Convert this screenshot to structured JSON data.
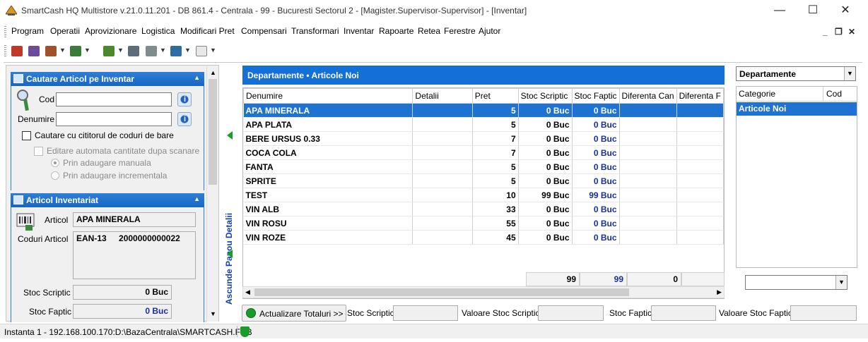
{
  "window": {
    "title": "SmartCash HQ Multistore v.21.0.11.201 - DB 861.4 - Centrala - 99 - Bucuresti Sectorul 2 - [Magister.Supervisor-Supervisor] - [Inventar]",
    "minimize": "—",
    "maximize": "☐",
    "close": "✕"
  },
  "menu": [
    "Program",
    "Operatii",
    "Aprovizionare",
    "Logistica",
    "Modificari Pret",
    "Compensari",
    "Transformari",
    "Inventar",
    "Rapoarte",
    "Retea",
    "Ferestre",
    "Ajutor"
  ],
  "mdi": {
    "minimize": "_",
    "restore": "❐",
    "close": "✕"
  },
  "search_group": {
    "title": "Cautare Articol pe Inventar",
    "cod_label": "Cod",
    "cod_value": "",
    "denumire_label": "Denumire",
    "denumire_value": "",
    "barcode_reader_label": "Cautare cu cititorul de coduri de bare",
    "auto_edit_label": "Editare automata cantitate dupa scanare",
    "manual_add_label": "Prin adaugare manuala",
    "incremental_add_label": "Prin adaugare incrementala"
  },
  "article_group": {
    "title": "Articol Inventariat",
    "articol_label": "Articol",
    "articol_value": "APA MINERALA",
    "coduri_label": "Coduri Articol",
    "code_type": "EAN-13",
    "code_value": "2000000000022",
    "stoc_scriptic_label": "Stoc Scriptic",
    "stoc_scriptic_value": "0 Buc",
    "stoc_faptic_label": "Stoc Faptic",
    "stoc_faptic_value": "0 Buc"
  },
  "splitter_label": "Ascunde Panou Detalii",
  "grid": {
    "title": "Departamente • Articole Noi",
    "columns": [
      "Denumire",
      "Detalii",
      "Pret",
      "Stoc Scriptic",
      "Stoc Faptic",
      "Diferenta Can",
      "Diferenta F"
    ],
    "rows": [
      {
        "denumire": "APA MINERALA",
        "detalii": "",
        "pret": "5",
        "scriptic": "0 Buc",
        "faptic": "0 Buc"
      },
      {
        "denumire": "APA PLATA",
        "detalii": "",
        "pret": "5",
        "scriptic": "0 Buc",
        "faptic": "0 Buc"
      },
      {
        "denumire": "BERE URSUS 0.33",
        "detalii": "",
        "pret": "7",
        "scriptic": "0 Buc",
        "faptic": "0 Buc"
      },
      {
        "denumire": "COCA COLA",
        "detalii": "",
        "pret": "7",
        "scriptic": "0 Buc",
        "faptic": "0 Buc"
      },
      {
        "denumire": "FANTA",
        "detalii": "",
        "pret": "5",
        "scriptic": "0 Buc",
        "faptic": "0 Buc"
      },
      {
        "denumire": "SPRITE",
        "detalii": "",
        "pret": "5",
        "scriptic": "0 Buc",
        "faptic": "0 Buc"
      },
      {
        "denumire": "TEST",
        "detalii": "",
        "pret": "10",
        "scriptic": "99 Buc",
        "faptic": "99 Buc"
      },
      {
        "denumire": "VIN ALB",
        "detalii": "",
        "pret": "33",
        "scriptic": "0 Buc",
        "faptic": "0 Buc"
      },
      {
        "denumire": "VIN ROSU",
        "detalii": "",
        "pret": "55",
        "scriptic": "0 Buc",
        "faptic": "0 Buc"
      },
      {
        "denumire": "VIN ROZE",
        "detalii": "",
        "pret": "45",
        "scriptic": "0 Buc",
        "faptic": "0 Buc"
      }
    ],
    "totals": {
      "scriptic": "99",
      "faptic": "99",
      "diferenta": "0"
    }
  },
  "right_panel": {
    "select_value": "Departamente",
    "columns": [
      "Categorie",
      "Cod"
    ],
    "rows": [
      {
        "categorie": "Articole Noi",
        "cod": ""
      }
    ],
    "bottom_select_value": ""
  },
  "bottom_bar": {
    "update_button": "Actualizare Totaluri >>",
    "stoc_scriptic_label": "Stoc Scriptic",
    "valoare_stoc_scriptic_label": "Valoare Stoc Scriptic",
    "stoc_faptic_label": "Stoc Faptic",
    "valoare_stoc_faptic_label": "Valoare Stoc Faptic"
  },
  "status_bar": {
    "text": "Instanta 1 - 192.168.100.170:D:\\BazaCentrala\\SMARTCASH.FDB"
  },
  "colors": {
    "accent_blue": "#1470d6",
    "selection": "#1e72d2",
    "faptic_text": "#1a2f9c",
    "green": "#1a9c2a"
  }
}
